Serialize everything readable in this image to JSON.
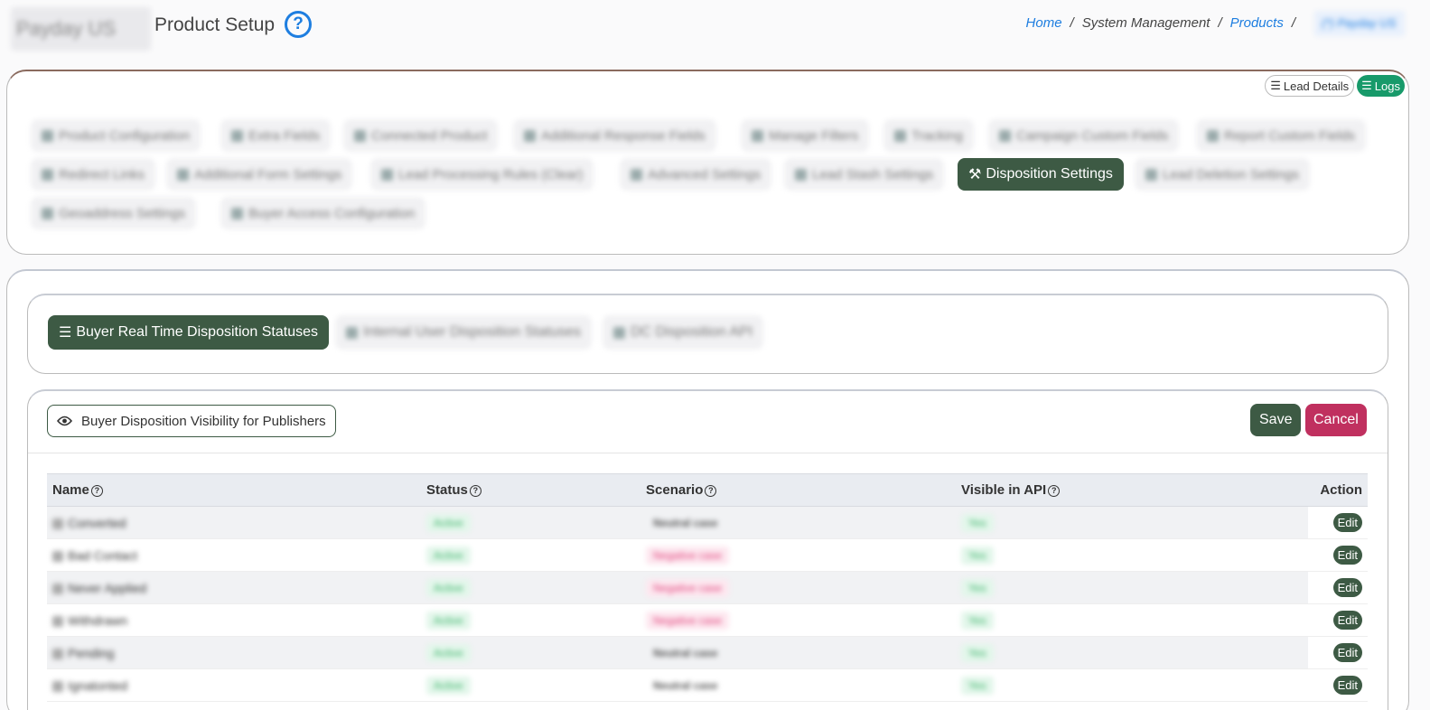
{
  "header": {
    "brand_text": "Payday US",
    "title": "Product Setup",
    "breadcrumb": {
      "home": "Home",
      "system_management": "System Management",
      "products": "Products",
      "current": "(*) Payday US"
    }
  },
  "top_actions": {
    "lead_details": "Lead Details",
    "logs": "Logs"
  },
  "product_tabs": [
    "Product Configuration",
    "Extra Fields",
    "Connected Product",
    "Additional Response Fields",
    "Manage Filters",
    "Tracking",
    "Campaign Custom Fields",
    "Report Custom Fields",
    "Redirect Links",
    "Additional Form Settings",
    "Lead Processing Rules (Clear)",
    "Advanced Settings",
    "Lead Stash Settings",
    "Disposition Settings",
    "Lead Deletion Settings",
    "Geoaddress Settings",
    "Buyer Access Configuration"
  ],
  "disposition_tabs": [
    "Buyer Real Time Disposition Statuses",
    "Internal User Disposition Statuses",
    "DC Disposition API"
  ],
  "toolbar": {
    "visibility_label": "Buyer Disposition Visibility for Publishers",
    "save_label": "Save",
    "cancel_label": "Cancel"
  },
  "table": {
    "columns": [
      "Name",
      "Status",
      "Scenario",
      "Visible in API",
      "Action"
    ],
    "rows": [
      {
        "name": "Converted",
        "status": "Active",
        "scenario": "Neutral case",
        "scenario_tone": "neutral",
        "visible": "Yes",
        "action": "Edit"
      },
      {
        "name": "Bad Contact",
        "status": "Active",
        "scenario": "Negative case",
        "scenario_tone": "negative",
        "visible": "Yes",
        "action": "Edit"
      },
      {
        "name": "Never Applied",
        "status": "Active",
        "scenario": "Negative case",
        "scenario_tone": "negative",
        "visible": "Yes",
        "action": "Edit"
      },
      {
        "name": "Withdrawn",
        "status": "Active",
        "scenario": "Negative case",
        "scenario_tone": "negative",
        "visible": "Yes",
        "action": "Edit"
      },
      {
        "name": "Pending",
        "status": "Active",
        "scenario": "Neutral case",
        "scenario_tone": "neutral",
        "visible": "Yes",
        "action": "Edit"
      },
      {
        "name": "Ignatonted",
        "status": "Active",
        "scenario": "Neutral case",
        "scenario_tone": "neutral",
        "visible": "Yes",
        "action": "Edit"
      }
    ]
  }
}
